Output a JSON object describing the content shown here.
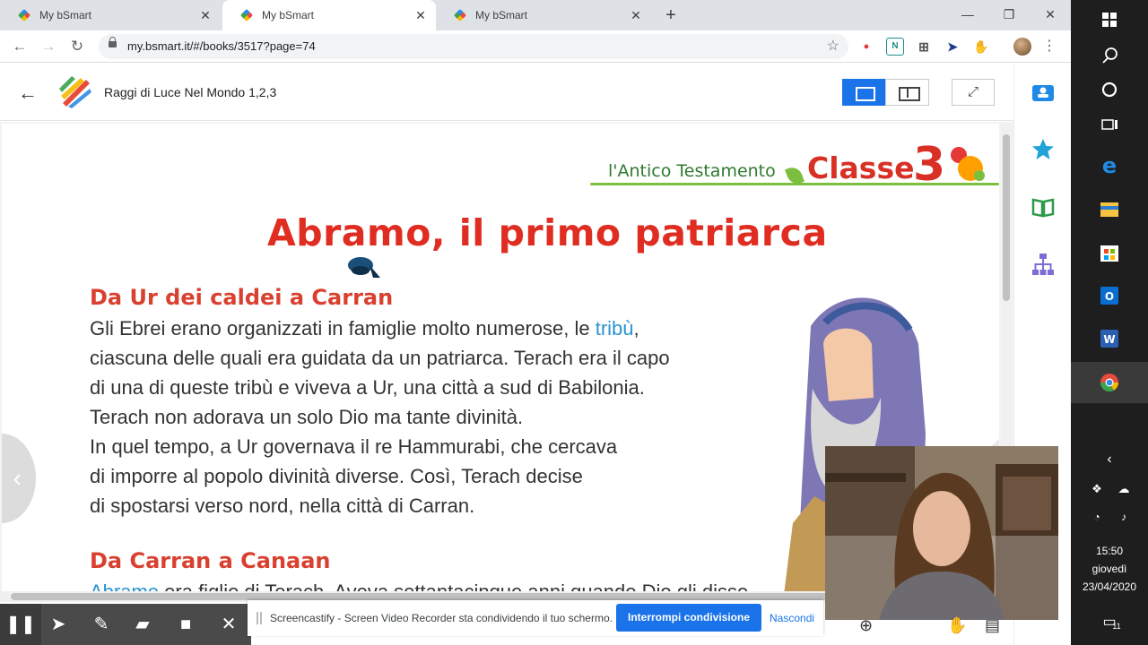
{
  "browser": {
    "tabs": [
      {
        "title": "My bSmart",
        "active": false
      },
      {
        "title": "My bSmart",
        "active": true
      },
      {
        "title": "My bSmart",
        "active": false
      }
    ],
    "new_tab_icon": "plus-icon",
    "url": "my.bsmart.it/#/books/3517?page=74",
    "extensions": [
      "screencastify-icon",
      "n-icon",
      "grid-icon",
      "arrow-icon",
      "hand-icon"
    ]
  },
  "app": {
    "book_title": "Raggi di Luce Nel Mondo 1,2,3",
    "colors": {
      "accent": "#1a73e8",
      "title_red": "#e02d22",
      "term_blue": "#2a93cf",
      "green": "#7cbf3e"
    }
  },
  "page": {
    "section_tag": "l'Antico Testamento",
    "class_label": "Classe",
    "class_number": "3",
    "chapter_title": "Abramo, il primo patriarca",
    "subhead_1": "Da Ur dei caldei a Carran",
    "para1": {
      "l1_pre": "Gli Ebrei erano organizzati in famiglie molto numerose, le ",
      "l1_term": "tribù",
      "l1_post": ",",
      "l2": "ciascuna delle quali era guidata da un patriarca. Terach era il capo",
      "l3": "di una di queste tribù e viveva a Ur, una città a sud di Babilonia.",
      "l4": "Terach non adorava un solo Dio ma tante divinità.",
      "l5": "In quel tempo, a Ur governava il re Hammurabi, che cercava",
      "l6": "di imporre al popolo divinità diverse. Così, Terach decise",
      "l7": "di spostarsi verso nord, nella città di Carran."
    },
    "subhead_2": "Da Carran a Canaan",
    "para2_clipped": {
      "term": "Abramo",
      "rest": " era figlio di Terach. Aveva settantacinque anni quando Dio gli disse"
    },
    "prev_glyph": "‹",
    "next_glyph": "›"
  },
  "screencastify": {
    "notice": "Screencastify - Screen Video Recorder sta condividendo il tuo schermo.",
    "stop_label": "Interrompi condivisione",
    "hide_label": "Nascondi"
  },
  "taskbar": {
    "time": "15:50",
    "day": "giovedì",
    "date": "23/04/2020",
    "notifications": "11"
  }
}
